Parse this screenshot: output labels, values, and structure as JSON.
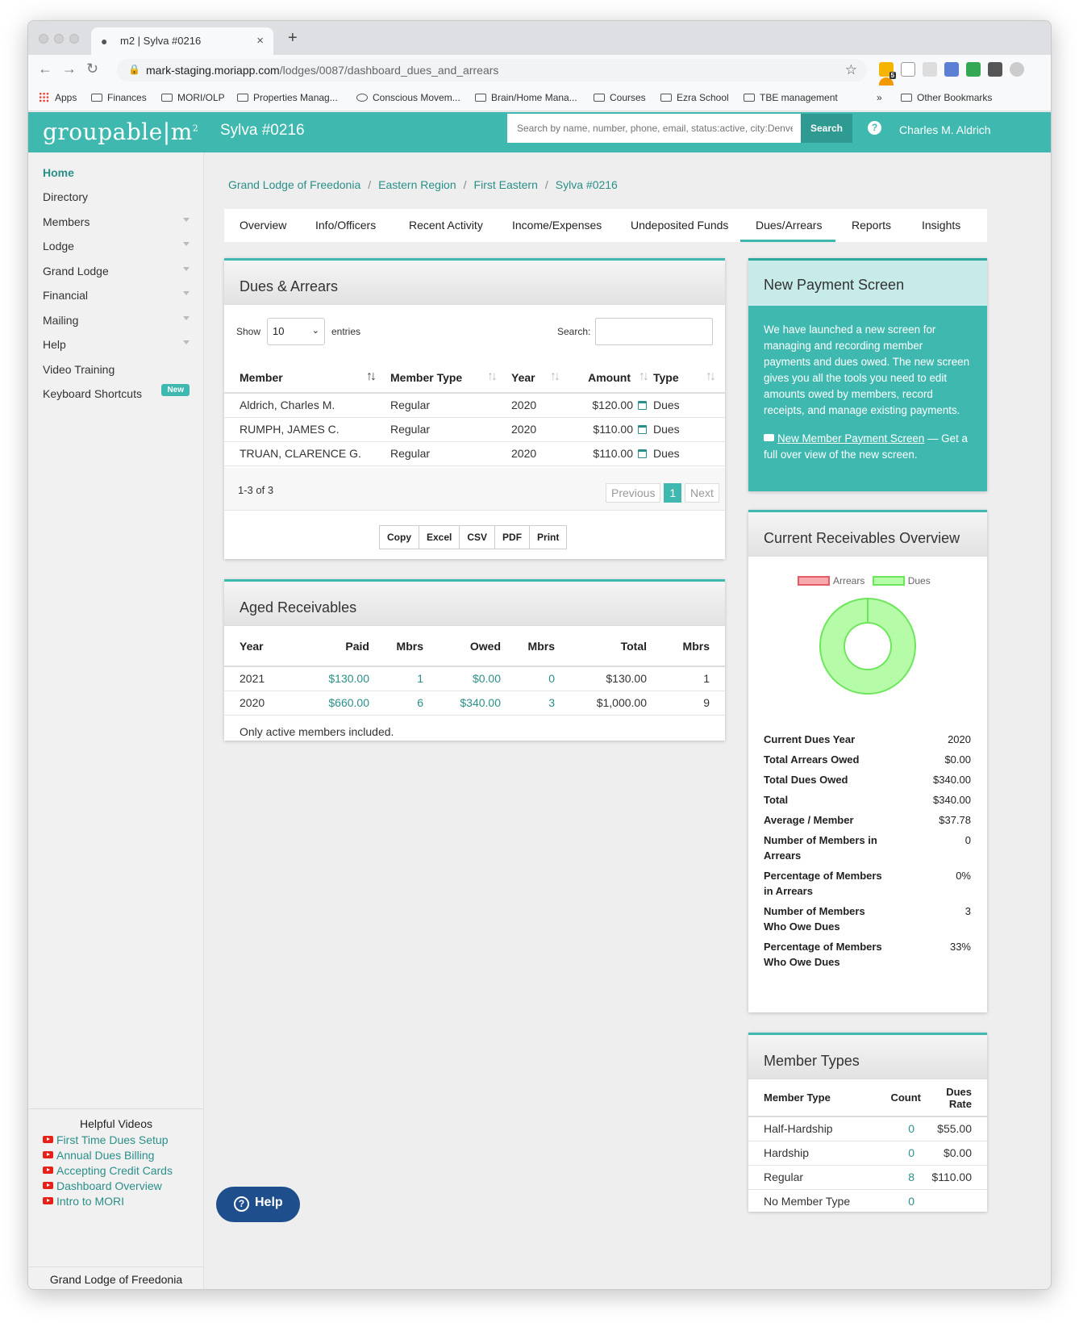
{
  "browser": {
    "tab_title": "m2 | Sylva #0216",
    "url_host": "mark-staging.moriapp.com",
    "url_path": "/lodges/0087/dashboard_dues_and_arrears",
    "bookmarks": [
      "Apps",
      "Finances",
      "MORI/OLP",
      "Properties Manag...",
      "Conscious Movem...",
      "Brain/Home Mana...",
      "Courses",
      "Ezra School",
      "TBE management",
      "Other Bookmarks"
    ],
    "more": "»",
    "ext_badge": "5"
  },
  "header": {
    "logo": "groupable|m",
    "logo_sup": "2",
    "lodge_name": "Sylva #0216",
    "search_placeholder": "Search by name, number, phone, email, status:active, city:Denver",
    "search_button": "Search",
    "help_icon": "?",
    "user_name": "Charles M. Aldrich"
  },
  "sidebar": {
    "items": [
      "Home",
      "Directory",
      "Members",
      "Lodge",
      "Grand Lodge",
      "Financial",
      "Mailing",
      "Help",
      "Video Training",
      "Keyboard Shortcuts"
    ],
    "new_badge": "New",
    "helpful_title": "Helpful Videos",
    "videos": [
      "First Time Dues Setup",
      "Annual Dues Billing",
      "Accepting Credit Cards",
      "Dashboard Overview",
      "Intro to MORI"
    ],
    "footer": "Grand Lodge of Freedonia"
  },
  "breadcrumb": [
    "Grand Lodge of Freedonia",
    "Eastern Region",
    "First Eastern",
    "Sylva #0216"
  ],
  "tabs": [
    "Overview",
    "Info/Officers",
    "Recent Activity",
    "Income/Expenses",
    "Undeposited Funds",
    "Dues/Arrears",
    "Reports",
    "Insights"
  ],
  "dues_arrears": {
    "title": "Dues & Arrears",
    "show_label": "Show",
    "show_value": "10",
    "entries_label": "entries",
    "search_label": "Search:",
    "columns": [
      "Member",
      "Member Type",
      "Year",
      "Amount",
      "Type"
    ],
    "rows": [
      {
        "member": "Aldrich, Charles M.",
        "type": "Regular",
        "year": "2020",
        "amount": "$120.00",
        "kind": "Dues"
      },
      {
        "member": "RUMPH, JAMES C.",
        "type": "Regular",
        "year": "2020",
        "amount": "$110.00",
        "kind": "Dues"
      },
      {
        "member": "TRUAN, CLARENCE G.",
        "type": "Regular",
        "year": "2020",
        "amount": "$110.00",
        "kind": "Dues"
      }
    ],
    "info": "1-3 of 3",
    "prev": "Previous",
    "page": "1",
    "next": "Next",
    "export": [
      "Copy",
      "Excel",
      "CSV",
      "PDF",
      "Print"
    ]
  },
  "aged": {
    "title": "Aged Receivables",
    "columns": [
      "Year",
      "Paid",
      "Mbrs",
      "Owed",
      "Mbrs",
      "Total",
      "Mbrs"
    ],
    "rows": [
      [
        "2021",
        "$130.00",
        "1",
        "$0.00",
        "0",
        "$130.00",
        "1"
      ],
      [
        "2020",
        "$660.00",
        "6",
        "$340.00",
        "3",
        "$1,000.00",
        "9"
      ]
    ],
    "note": "Only active members included."
  },
  "new_payment": {
    "title": "New Payment Screen",
    "body": "We have launched a new screen for managing and recording member payments and dues owed. The new screen gives you all the tools you need to edit amounts owed by members, record receipts, and manage existing payments.",
    "link": "New Member Payment Screen",
    "link_suffix": " — Get a full over view of the new screen."
  },
  "receivables": {
    "title": "Current Receivables Overview",
    "legend": [
      "Arrears",
      "Dues"
    ],
    "colors": {
      "arrears": "#f8a9ad",
      "dues": "#b5fba8",
      "arrears_border": "#e65c66",
      "dues_border": "#6de65c"
    },
    "chart_data": {
      "type": "pie",
      "categories": [
        "Arrears",
        "Dues"
      ],
      "values": [
        0,
        340
      ]
    },
    "stats": [
      {
        "k": "Current Dues Year",
        "v": "2020"
      },
      {
        "k": "Total Arrears Owed",
        "v": "$0.00"
      },
      {
        "k": "Total Dues Owed",
        "v": "$340.00"
      },
      {
        "k": "Total",
        "v": "$340.00"
      },
      {
        "k": "Average / Member",
        "v": "$37.78"
      },
      {
        "k": "Number of Members in Arrears",
        "v": "0"
      },
      {
        "k": "Percentage of Members in Arrears",
        "v": "0%"
      },
      {
        "k": "Number of Members Who Owe Dues",
        "v": "3"
      },
      {
        "k": "Percentage of Members Who Owe Dues",
        "v": "33%"
      }
    ]
  },
  "member_types": {
    "title": "Member Types",
    "columns": [
      "Member Type",
      "Count",
      "Dues Rate"
    ],
    "rows": [
      [
        "Half-Hardship",
        "0",
        "$55.00"
      ],
      [
        "Hardship",
        "0",
        "$0.00"
      ],
      [
        "Regular",
        "8",
        "$110.00"
      ],
      [
        "No Member Type",
        "0",
        ""
      ]
    ]
  },
  "floating_help": "Help"
}
